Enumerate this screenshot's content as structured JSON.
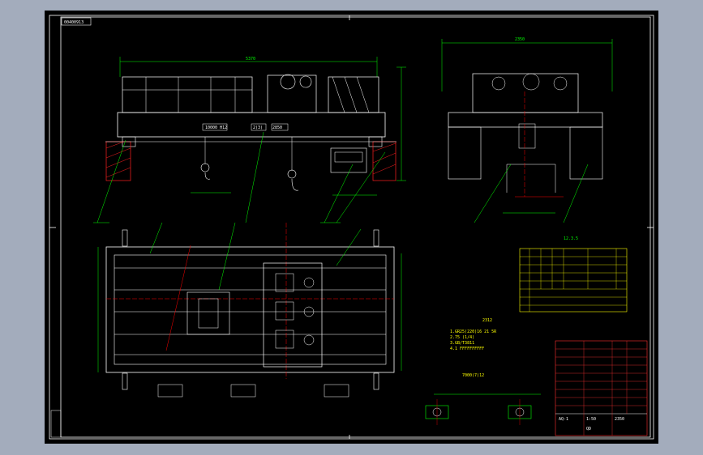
{
  "colors": {
    "viewport_bg": "#a3acbc",
    "sheet_bg": "#000000",
    "frame": "#ffffff",
    "outline": "#00ff00",
    "detail": "#ffffff",
    "centerline": "#ff0000",
    "leader": "#00ff00",
    "table": "#ffff00",
    "titleblock": "#ff3030",
    "hatch": "#ff2020"
  },
  "drawing": {
    "title_tag": "00400913",
    "cad_icons": [
      "frame-border-icon",
      "crane-elevation-icon",
      "crane-plan-icon",
      "trolley-side-icon",
      "parts-table-icon",
      "title-block-icon",
      "wheel-detail-icon"
    ],
    "overall_dim": "5370",
    "gauge_dim": "2350",
    "label_a": "10000 H12",
    "label_b": "2(3)",
    "label_c": "2850",
    "note_top": "12.3.5",
    "note_mid": "2312",
    "note_bottom": "7000(7)12",
    "tech_note_line1": "1.GR25(220)16 21 5R",
    "tech_note_line2": "2.75 (1/4)",
    "tech_note_line3": "3.GB/T3811",
    "tech_note_line4": "4.1 FFFFFFFFFF",
    "title_block": {
      "drawing_no": "AQ-1",
      "scale": "1:50",
      "sheet": "2350",
      "name": "QD"
    }
  }
}
